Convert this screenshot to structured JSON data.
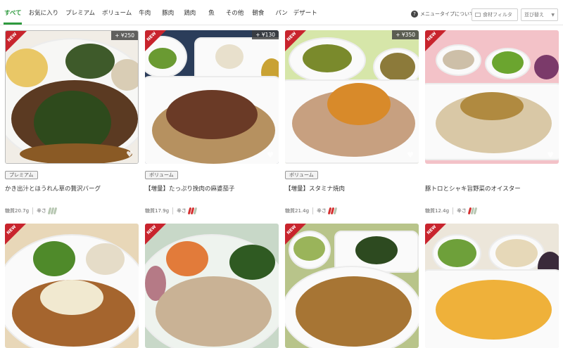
{
  "nav": {
    "tabs": [
      "すべて",
      "お気に入り",
      "プレミアム",
      "ボリューム",
      "牛肉",
      "豚肉",
      "鶏肉",
      "魚",
      "その他",
      "朝食",
      "パン",
      "デザート"
    ],
    "help_label": "メニュータイプについて",
    "filter_label": "食材フィルタ",
    "sort_label": "並び替え"
  },
  "cards": [
    {
      "name": "かき出汁とほうれん草の贅沢バーグ",
      "price": "+ ¥250",
      "tag": "プレミアム",
      "carbs": "糖質20.7g",
      "spice_label": "辛さ",
      "spice_level": 0,
      "new": "NEW"
    },
    {
      "name": "【増量】たっぷり挽肉の麻婆茄子",
      "price": "+ ¥130",
      "tag": "ボリューム",
      "carbs": "糖質17.9g",
      "spice_label": "辛さ",
      "spice_level": 2,
      "new": "NEW"
    },
    {
      "name": "【増量】スタミナ焼肉",
      "price": "+ ¥350",
      "tag": "ボリューム",
      "carbs": "糖質21.4g",
      "spice_label": "辛さ",
      "spice_level": 2,
      "new": "NEW"
    },
    {
      "name": "豚トロとシャキ旨野菜のオイスター",
      "price": "",
      "tag": "",
      "carbs": "糖質12.4g",
      "spice_label": "辛さ",
      "spice_level": 1,
      "new": "NEW"
    },
    {
      "name": "",
      "price": "",
      "tag": "",
      "carbs": "",
      "spice_label": "",
      "spice_level": 0,
      "new": "NEW"
    },
    {
      "name": "",
      "price": "",
      "tag": "",
      "carbs": "",
      "spice_label": "",
      "spice_level": 0,
      "new": "NEW"
    },
    {
      "name": "",
      "price": "",
      "tag": "",
      "carbs": "",
      "spice_label": "",
      "spice_level": 0,
      "new": "NEW"
    },
    {
      "name": "",
      "price": "",
      "tag": "",
      "carbs": "",
      "spice_label": "",
      "spice_level": 0,
      "new": "NEW"
    }
  ],
  "colors": {
    "accent": "#2e9a3e",
    "new_badge": "#c8242d",
    "pepper_on": "#d32e2e",
    "pepper_off": "#b7c7b2"
  },
  "icons": {
    "help": "question-circle-icon",
    "filter": "filter-icon",
    "sort": "chevron-down-icon",
    "favorite": "heart-icon"
  }
}
